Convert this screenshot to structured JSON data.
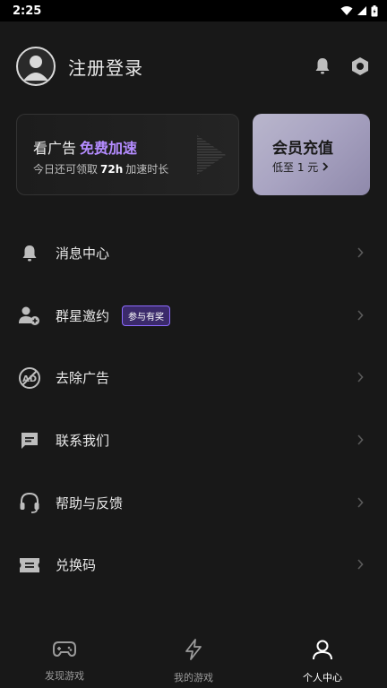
{
  "status_bar": {
    "time": "2:25"
  },
  "profile": {
    "login_label": "注册登录"
  },
  "ad_card": {
    "title_prefix": "看广告",
    "title_accent": "免费加速",
    "sub_prefix": "今日还可领取",
    "sub_hours": "72h",
    "sub_suffix": "加速时长"
  },
  "vip_card": {
    "title": "会员充值",
    "subtitle": "低至 1 元"
  },
  "menu": {
    "items": [
      {
        "label": "消息中心",
        "icon": "bell-icon"
      },
      {
        "label": "群星邀约",
        "icon": "add-user-icon",
        "badge": "参与有奖"
      },
      {
        "label": "去除广告",
        "icon": "no-ad-icon"
      },
      {
        "label": "联系我们",
        "icon": "chat-icon"
      },
      {
        "label": "帮助与反馈",
        "icon": "headset-icon"
      },
      {
        "label": "兑换码",
        "icon": "ticket-icon"
      }
    ]
  },
  "tabbar": {
    "tabs": [
      {
        "label": "发现游戏",
        "icon": "gamepad-icon",
        "active": false
      },
      {
        "label": "我的游戏",
        "icon": "lightning-icon",
        "active": false
      },
      {
        "label": "个人中心",
        "icon": "person-icon",
        "active": true
      }
    ]
  },
  "colors": {
    "background": "#181818",
    "accent": "#b48cff",
    "vip_card": "#a9a4c2"
  }
}
